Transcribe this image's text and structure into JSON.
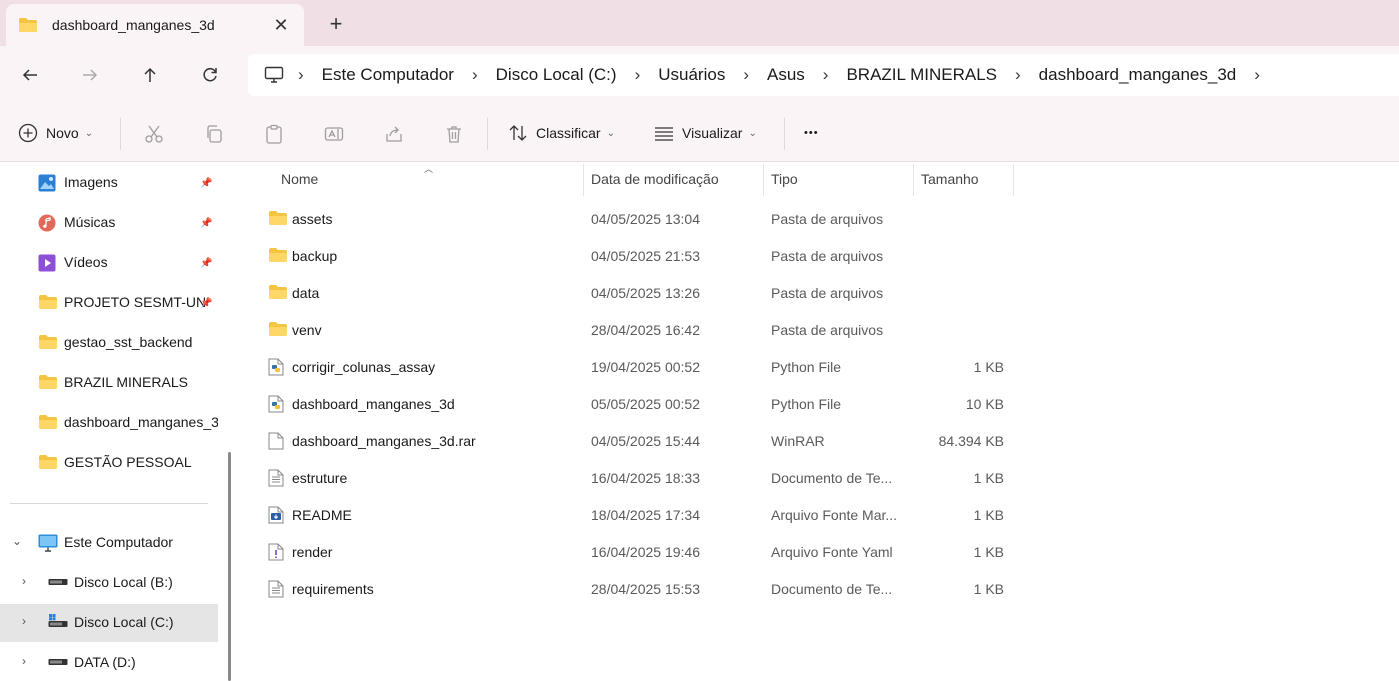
{
  "tab": {
    "title": "dashboard_manganes_3d",
    "close": "✕",
    "add": "+"
  },
  "breadcrumb": [
    "Este Computador",
    "Disco Local (C:)",
    "Usuários",
    "Asus",
    "BRAZIL MINERALS",
    "dashboard_manganes_3d"
  ],
  "commands": {
    "new": "Novo",
    "sort": "Classificar",
    "view": "Visualizar",
    "more": "•••"
  },
  "sidebar": {
    "quick": [
      {
        "label": "Imagens",
        "icon": "images-icon",
        "pinned": true
      },
      {
        "label": "Músicas",
        "icon": "music-icon",
        "pinned": true
      },
      {
        "label": "Vídeos",
        "icon": "videos-icon",
        "pinned": true
      },
      {
        "label": "PROJETO SESMT-UN",
        "icon": "folder-icon",
        "pinned": true
      },
      {
        "label": "gestao_sst_backend",
        "icon": "folder-icon",
        "pinned": false
      },
      {
        "label": "BRAZIL MINERALS",
        "icon": "folder-icon",
        "pinned": false
      },
      {
        "label": "dashboard_manganes_3",
        "icon": "folder-icon",
        "pinned": false
      },
      {
        "label": "GESTÃO PESSOAL",
        "icon": "folder-icon",
        "pinned": false
      }
    ],
    "computer": "Este Computador",
    "drives": [
      {
        "label": "Disco Local (B:)",
        "selected": false
      },
      {
        "label": "Disco Local (C:)",
        "selected": true
      },
      {
        "label": "DATA (D:)",
        "selected": false
      }
    ]
  },
  "columns": {
    "name": "Nome",
    "date": "Data de modificação",
    "type": "Tipo",
    "size": "Tamanho"
  },
  "files": [
    {
      "name": "assets",
      "date": "04/05/2025 13:04",
      "type": "Pasta de arquivos",
      "size": "",
      "icon": "folder-icon"
    },
    {
      "name": "backup",
      "date": "04/05/2025 21:53",
      "type": "Pasta de arquivos",
      "size": "",
      "icon": "folder-icon"
    },
    {
      "name": "data",
      "date": "04/05/2025 13:26",
      "type": "Pasta de arquivos",
      "size": "",
      "icon": "folder-icon"
    },
    {
      "name": "venv",
      "date": "28/04/2025 16:42",
      "type": "Pasta de arquivos",
      "size": "",
      "icon": "folder-icon"
    },
    {
      "name": "corrigir_colunas_assay",
      "date": "19/04/2025 00:52",
      "type": "Python File",
      "size": "1 KB",
      "icon": "python-file-icon"
    },
    {
      "name": "dashboard_manganes_3d",
      "date": "05/05/2025 00:52",
      "type": "Python File",
      "size": "10 KB",
      "icon": "python-file-icon"
    },
    {
      "name": "dashboard_manganes_3d.rar",
      "date": "04/05/2025 15:44",
      "type": "WinRAR",
      "size": "84.394 KB",
      "icon": "blank-file-icon"
    },
    {
      "name": "estruture",
      "date": "16/04/2025 18:33",
      "type": "Documento de Te...",
      "size": "1 KB",
      "icon": "text-file-icon"
    },
    {
      "name": "README",
      "date": "18/04/2025 17:34",
      "type": "Arquivo Fonte Mar...",
      "size": "1 KB",
      "icon": "markdown-file-icon"
    },
    {
      "name": "render",
      "date": "16/04/2025 19:46",
      "type": "Arquivo Fonte Yaml",
      "size": "1 KB",
      "icon": "yaml-file-icon"
    },
    {
      "name": "requirements",
      "date": "28/04/2025 15:53",
      "type": "Documento de Te...",
      "size": "1 KB",
      "icon": "text-file-icon"
    }
  ],
  "colors": {
    "folder": "#f5c542",
    "accent": "#0067c0",
    "tabbar": "#f1dfe6",
    "chrome": "#fbf4f7"
  }
}
